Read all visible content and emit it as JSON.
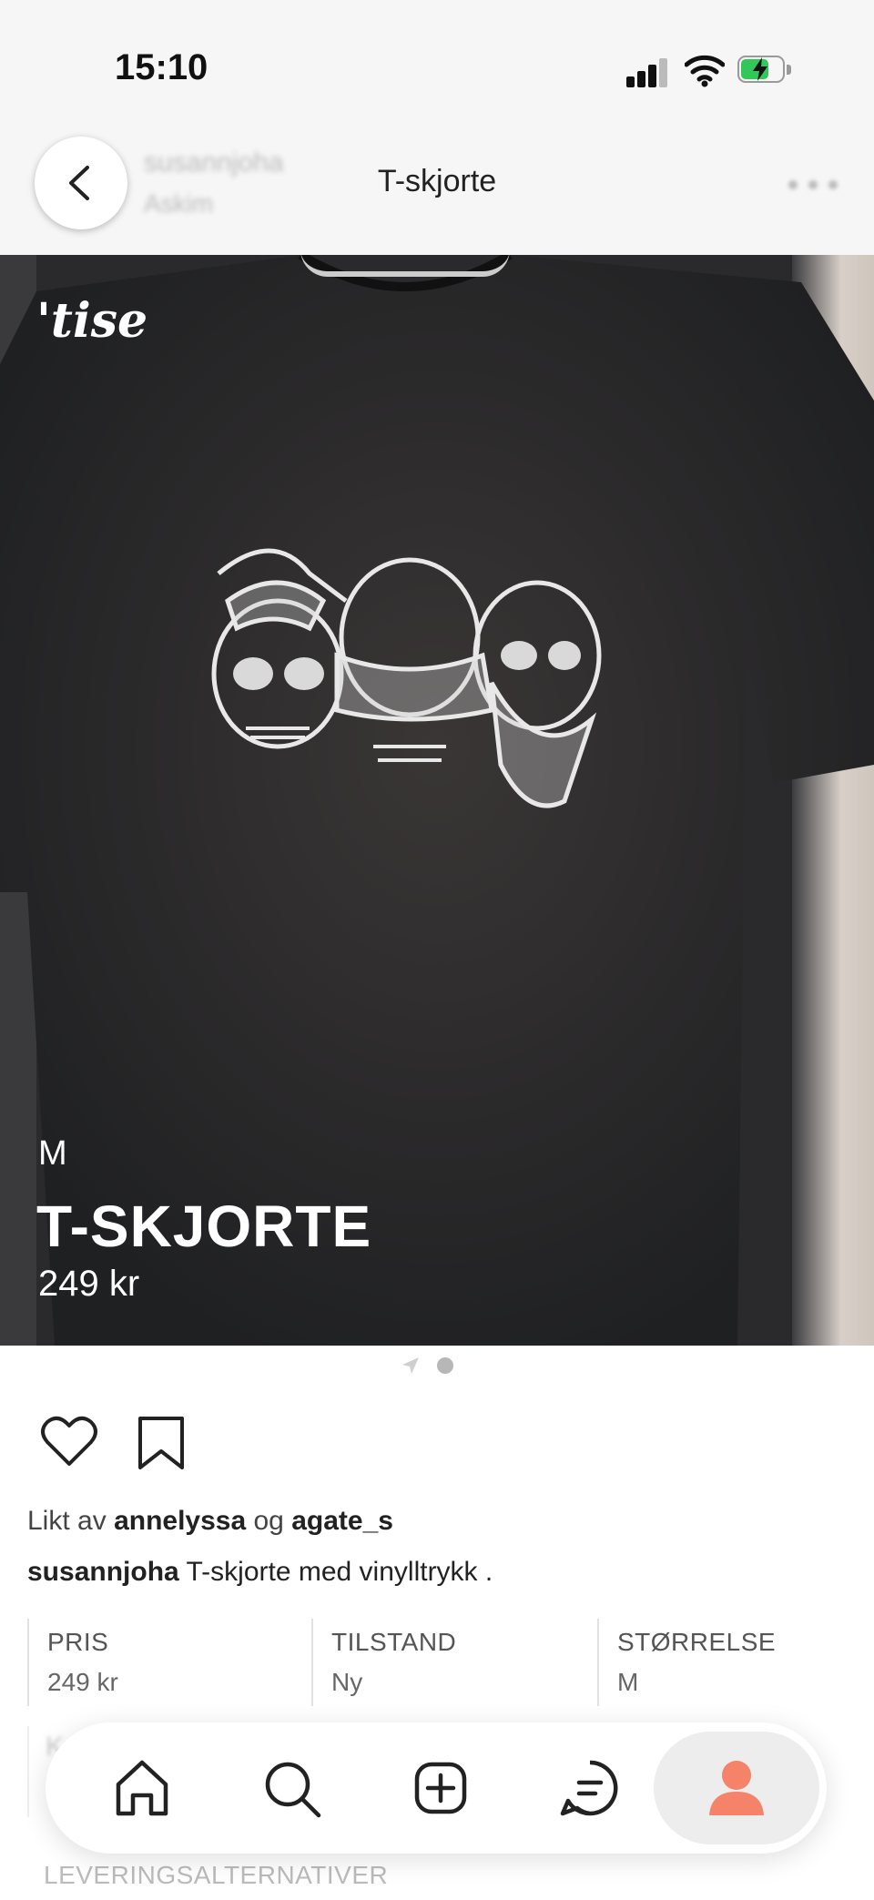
{
  "status_bar": {
    "time": "15:10"
  },
  "header": {
    "seller_name": "susannjoha",
    "seller_location": "Askim",
    "title": "T-skjorte"
  },
  "photo": {
    "brand_watermark": "'tise",
    "size": "M",
    "title": "T-SKJORTE",
    "price": "249 kr"
  },
  "pager": {
    "current_page": 2,
    "total_pages": 2
  },
  "likes": {
    "prefix": "Likt av",
    "user1": "annelyssa",
    "joiner": "og",
    "user2": "agate_s"
  },
  "description": {
    "user": "susannjoha",
    "text": "T-skjorte med vinylltrykk ."
  },
  "details": [
    {
      "label": "PRIS",
      "value": "249 kr"
    },
    {
      "label": "TILSTAND",
      "value": "Ny"
    },
    {
      "label": "STØRRELSE",
      "value": "M"
    }
  ],
  "details_faded": [
    {
      "label": "K"
    }
  ],
  "delivery_heading": "LEVERINGSALTERNATIVER",
  "tabbar": {
    "items": [
      "home-icon",
      "search-icon",
      "add-icon",
      "chat-icon",
      "profile-icon"
    ],
    "accent_color": "#f4836a"
  }
}
